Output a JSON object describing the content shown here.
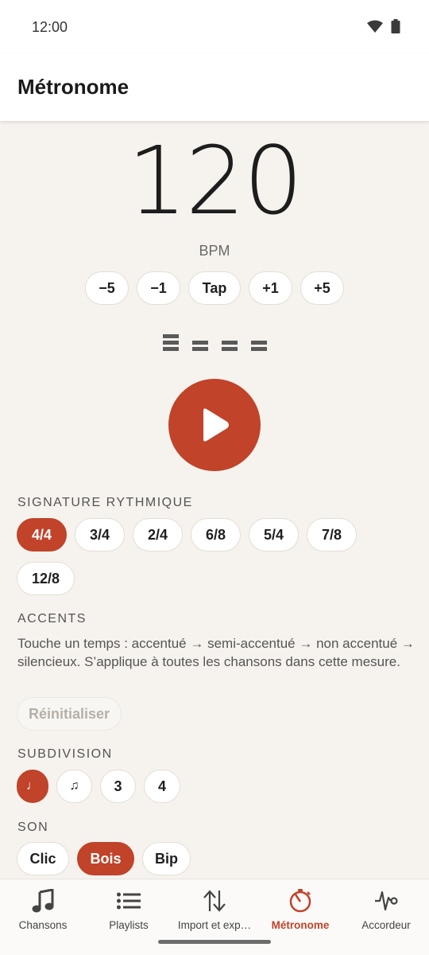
{
  "status_bar": {
    "time": "12:00"
  },
  "app_bar": {
    "title": "Métronome"
  },
  "tempo": {
    "bpm": "120",
    "unit_label": "BPM",
    "adjust_buttons": [
      "−5",
      "−1",
      "Tap",
      "+1",
      "+5"
    ]
  },
  "beats": [
    {
      "accent": "accented"
    },
    {
      "accent": "semi-accented"
    },
    {
      "accent": "semi-accented"
    },
    {
      "accent": "semi-accented"
    }
  ],
  "play_button": {
    "icon": "play-icon",
    "color": "#c0432a"
  },
  "time_signature": {
    "title": "SIGNATURE RYTHMIQUE",
    "options": [
      "4/4",
      "3/4",
      "2/4",
      "6/8",
      "5/4",
      "7/8",
      "12/8"
    ],
    "selected": "4/4"
  },
  "accents": {
    "title": "ACCENTS",
    "description": "Touche un temps : accentué → semi-accentué → non accentué → silencieux. S’applique à toutes les chansons dans cette mesure.",
    "reset_label": "Réinitialiser"
  },
  "subdivision": {
    "title": "SUBDIVISION",
    "options": [
      "♩",
      "♫",
      "3",
      "4"
    ],
    "selected": "♩"
  },
  "sound": {
    "title": "SON",
    "options": [
      "Clic",
      "Bois",
      "Bip"
    ],
    "selected": "Bois"
  },
  "bottom_nav": {
    "items": [
      {
        "label": "Chansons",
        "icon": "music-note-icon"
      },
      {
        "label": "Playlists",
        "icon": "list-icon"
      },
      {
        "label": "Import et exp…",
        "icon": "import-export-icon"
      },
      {
        "label": "Métronome",
        "icon": "metronome-icon"
      },
      {
        "label": "Accordeur",
        "icon": "tuner-icon"
      }
    ],
    "active": "Métronome"
  },
  "colors": {
    "accent": "#c0432a",
    "background": "#f6f3ee"
  }
}
